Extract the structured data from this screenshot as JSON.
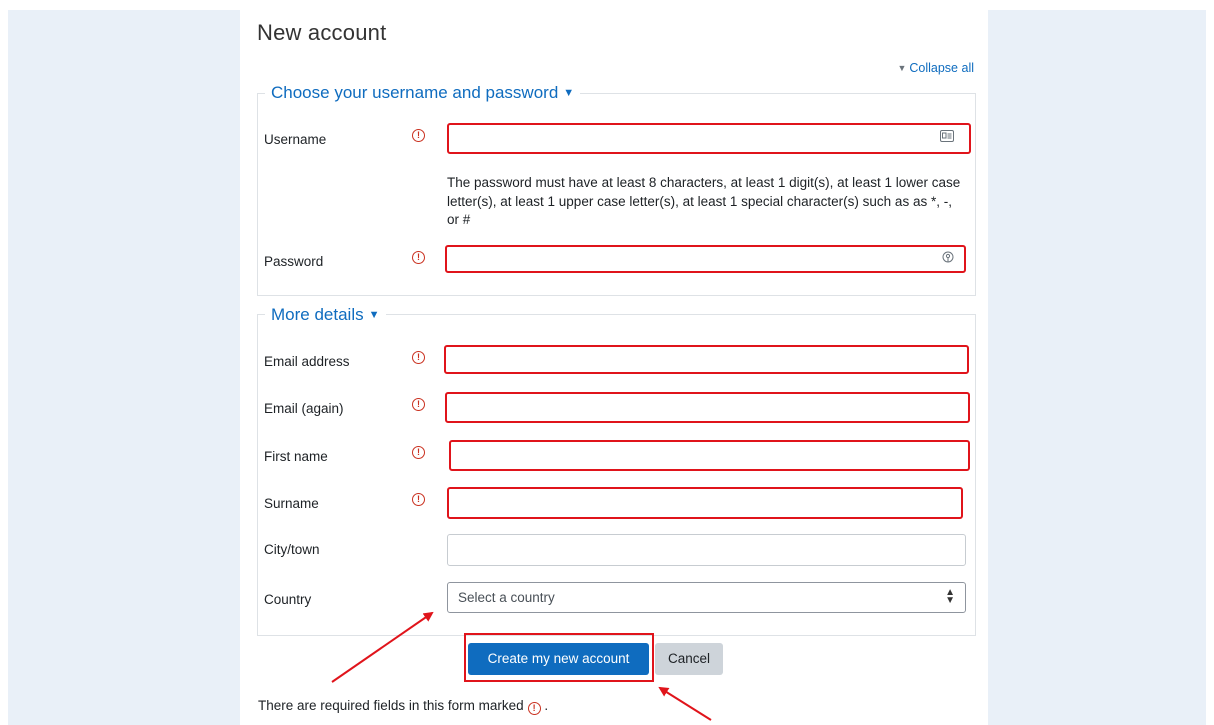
{
  "page": {
    "title": "New account",
    "collapse_all": "Collapse all",
    "required_note_prefix": "There are required fields in this form marked",
    "required_note_suffix": "."
  },
  "section_login": {
    "legend": "Choose your username and password",
    "username_label": "Username",
    "username_value": "",
    "password_policy": "The password must have at least 8 characters, at least 1 digit(s), at least 1 lower case letter(s), at least 1 upper case letter(s), at least 1 special character(s) such as as *, -, or #",
    "password_label": "Password",
    "password_value": ""
  },
  "section_details": {
    "legend": "More details",
    "email_label": "Email address",
    "email_again_label": "Email (again)",
    "first_name_label": "First name",
    "surname_label": "Surname",
    "city_label": "City/town",
    "country_label": "Country",
    "country_select": "Select a country"
  },
  "actions": {
    "create": "Create my new account",
    "cancel": "Cancel"
  },
  "colors": {
    "accent": "#0f6cbf",
    "required": "#ca3120",
    "annotation": "#e0141b"
  },
  "icons": {
    "collapse": "triangle-down-icon",
    "legend_caret": "caret-down-icon",
    "required": "exclamation-circle-icon",
    "username_field": "id-card-icon",
    "password_field": "key-icon",
    "select": "sort-icon"
  }
}
